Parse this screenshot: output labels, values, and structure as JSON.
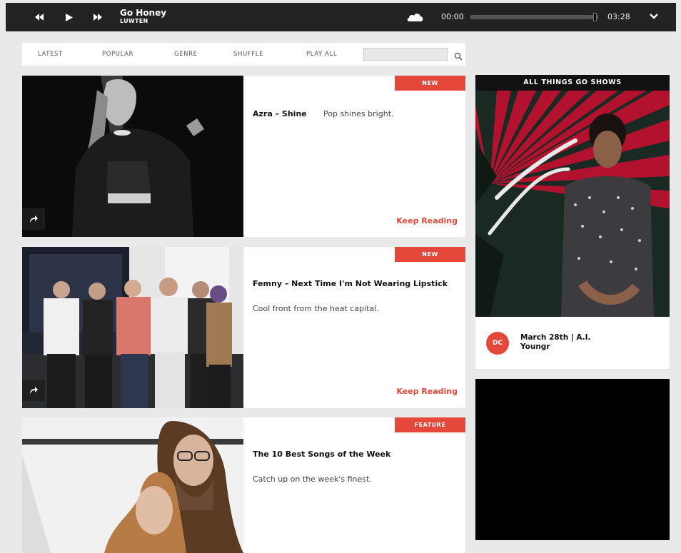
{
  "player": {
    "track_title": "Go Honey",
    "track_artist": "LUWTEN",
    "time_current": "00:00",
    "time_total": "03:28",
    "progress": 0.0,
    "icons": [
      "rewind-icon",
      "play-icon",
      "fast-forward-icon",
      "soundcloud-icon",
      "chevron-down-icon"
    ]
  },
  "nav": {
    "items": [
      "LATEST",
      "POPULAR",
      "GENRE",
      "SHUFFLE",
      "PLAY ALL"
    ],
    "search_value": ""
  },
  "posts": [
    {
      "badge": "NEW",
      "title": "Azra – Shine",
      "desc": "Pop shines bright.",
      "link": "Keep Reading"
    },
    {
      "badge": "NEW",
      "title": "Femny – Next Time I'm Not Wearing Lipstick",
      "desc": "Cool front from the heat capital.",
      "link": "Keep Reading"
    },
    {
      "badge": "FEATURE",
      "title": "The 10 Best Songs of the Week",
      "desc": "Catch up on the week's finest.",
      "link": ""
    }
  ],
  "sidebar": {
    "title": "ALL THINGS GO SHOWS",
    "event_badge": "DC",
    "event_line1": "March 28th | A.I.",
    "event_line2": "Youngr"
  },
  "colors": {
    "accent": "#e3483a",
    "player_bg": "#222222",
    "page_bg": "#e9e9e9"
  }
}
